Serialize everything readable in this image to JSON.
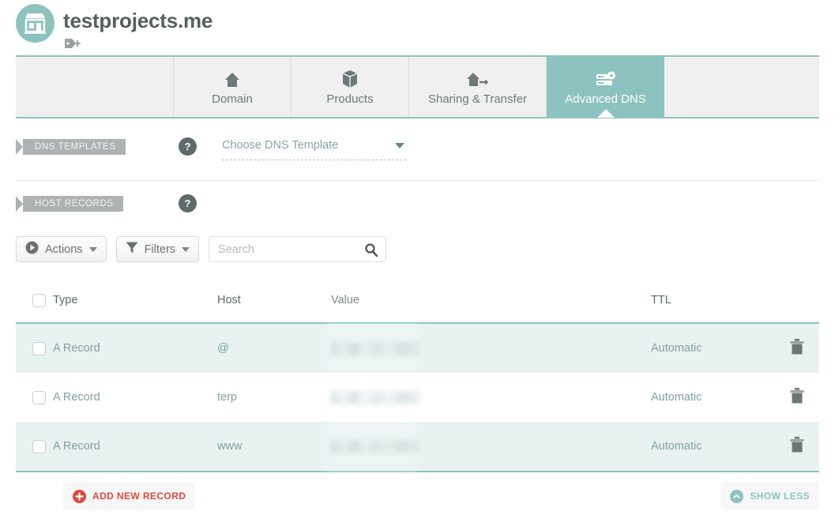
{
  "header": {
    "domain_title": "testprojects.me",
    "logo_icon": "storefront-icon",
    "add_tag_icon": "tag-plus-icon",
    "brand_teal": "#8cc3c0"
  },
  "tabs": [
    {
      "label": "Domain",
      "icon": "home-icon",
      "active": false
    },
    {
      "label": "Products",
      "icon": "box-icon",
      "active": false
    },
    {
      "label": "Sharing & Transfer",
      "icon": "transfer-icon",
      "active": false
    },
    {
      "label": "Advanced DNS",
      "icon": "dns-server-icon",
      "active": true
    }
  ],
  "sections": {
    "dns_templates": {
      "ribbon_label": "DNS TEMPLATES",
      "help_label": "?",
      "select_value": "Choose DNS Template"
    },
    "host_records": {
      "ribbon_label": "HOST RECORDS",
      "help_label": "?"
    }
  },
  "toolbar": {
    "actions_label": "Actions",
    "actions_icon": "play-circle-icon",
    "filters_label": "Filters",
    "filters_icon": "funnel-icon",
    "search_placeholder": "Search",
    "search_value": "",
    "search_icon": "search-icon"
  },
  "table": {
    "columns": [
      "Type",
      "Host",
      "Value",
      "TTL"
    ],
    "rows": [
      {
        "type": "A Record",
        "host": "@",
        "value": "",
        "value_redacted": true,
        "ttl": "Automatic"
      },
      {
        "type": "A Record",
        "host": "terp",
        "value": "",
        "value_redacted": true,
        "ttl": "Automatic"
      },
      {
        "type": "A Record",
        "host": "www",
        "value": "",
        "value_redacted": true,
        "ttl": "Automatic"
      }
    ],
    "delete_icon": "trash-icon",
    "select_all_checkbox": false
  },
  "footer": {
    "add_label": "ADD NEW RECORD",
    "add_icon": "plus-circle-icon",
    "add_color": "#e0483c",
    "show_less_label": "SHOW LESS",
    "show_less_icon": "chevron-up-icon",
    "show_less_color": "#8cc3c0"
  }
}
